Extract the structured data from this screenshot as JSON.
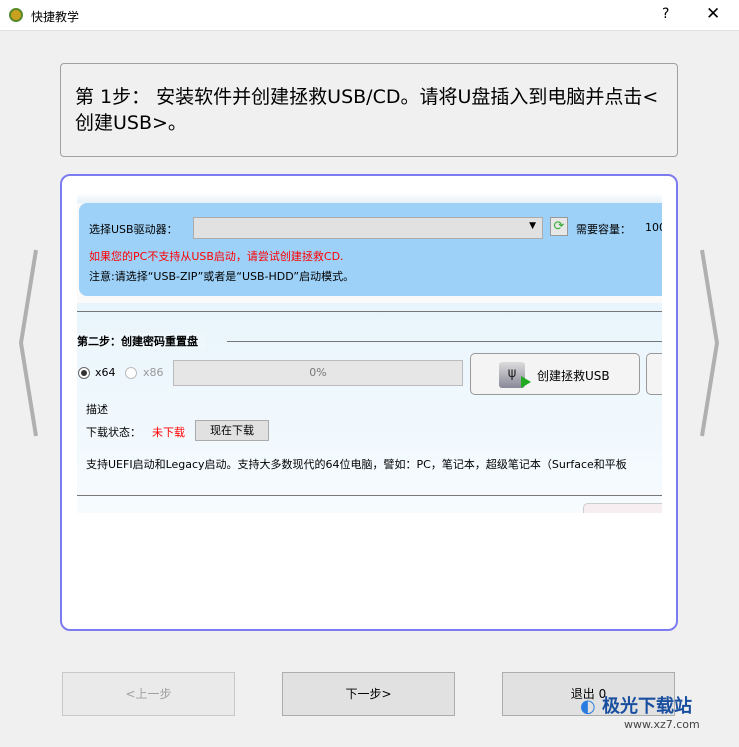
{
  "window": {
    "title": "快捷教学",
    "help": "?",
    "close": "✕"
  },
  "step": {
    "text": "第 1步：  安装软件并创建拯救USB/CD。请将U盘插入到电脑并点击<创建USB>。"
  },
  "screenshot": {
    "usb_label": "选择USB驱动器：",
    "capacity_label": "需要容量：",
    "capacity_value": "100",
    "warning": "如果您的PC不支持从USB启动，请尝试创建拯救CD.",
    "note": "注意:请选择“USB-ZIP”或者是“USB-HDD”启动模式。",
    "step2_title": "第二步：创建密码重置盘",
    "radio_x64": "x64",
    "radio_x86": "x86",
    "progress": "0%",
    "create_usb": "创建拯救USB",
    "desc_label": "描述",
    "download_status_label": "下载状态：",
    "download_status": "未下载",
    "download_now": "现在下载",
    "support_text": "支持UEFI启动和Legacy启动。支持大多数现代的64位电脑，譬如：PC，笔记本，超级笔记本（Surface和平板"
  },
  "nav": {
    "prev": "<上一步",
    "next": "下一步>",
    "exit": "退出 0"
  },
  "watermark": {
    "name": "极光下载站",
    "url": "www.xz7.com"
  }
}
